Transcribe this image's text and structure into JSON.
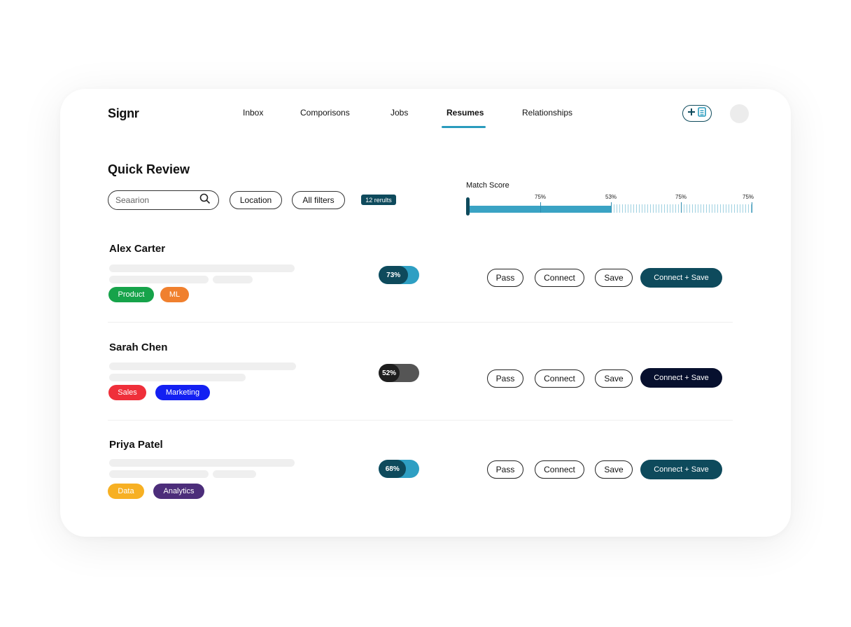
{
  "app": {
    "logo": "Signr"
  },
  "nav": {
    "items": [
      {
        "label": "Inbox"
      },
      {
        "label": "Comporisons"
      },
      {
        "label": "Jobs"
      },
      {
        "label": "Resumes",
        "active": true
      },
      {
        "label": "Relationships"
      }
    ]
  },
  "header": {
    "add_icon": "plus-document-icon",
    "avatar": "avatar"
  },
  "page": {
    "title": "Quick Review"
  },
  "filters": {
    "search_placeholder": "Seaarion",
    "location_label": "Location",
    "all_filters_label": "All filters",
    "results_badge": "12 rerults"
  },
  "match_score": {
    "label": "Match Score",
    "ticks": [
      "75%",
      "53%",
      "75%",
      "75%"
    ],
    "accent": "#3aa3c4"
  },
  "actions": {
    "pass": "Pass",
    "connect": "Connect",
    "save": "Save",
    "connect_save": "Connect + Save"
  },
  "candidates": [
    {
      "name": "Alex Carter",
      "score": "73%",
      "score_value": 0.73,
      "tags": [
        {
          "label": "Product",
          "color": "#16a34a"
        },
        {
          "label": "ML",
          "color": "#f0802e"
        }
      ]
    },
    {
      "name": "Sarah Chen",
      "score": "52%",
      "score_value": 0.52,
      "tags": [
        {
          "label": "Sales",
          "color": "#ef2f3a"
        },
        {
          "label": "Marketing",
          "color": "#1320f2"
        }
      ]
    },
    {
      "name": "Priya Patel",
      "score": "68%",
      "score_value": 0.68,
      "tags": [
        {
          "label": "Data",
          "color": "#f7b023"
        },
        {
          "label": "Analytics",
          "color": "#4c2d7a"
        }
      ]
    }
  ]
}
